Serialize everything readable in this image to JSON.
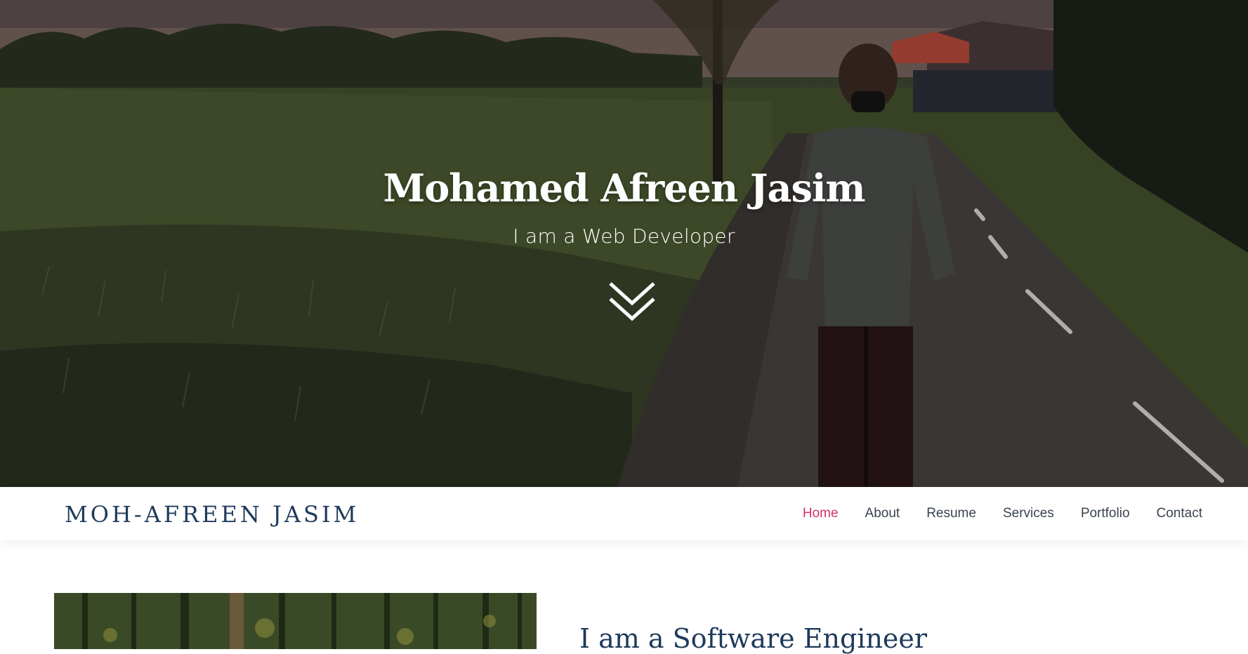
{
  "hero": {
    "title": "Mohamed Afreen Jasim",
    "subtitle": "I am a Web Developer",
    "scroll_icon": "double-chevron-down-icon"
  },
  "navbar": {
    "brand": "Moh-Afreen Jasim",
    "links": [
      {
        "label": "Home",
        "active": true
      },
      {
        "label": "About",
        "active": false
      },
      {
        "label": "Resume",
        "active": false
      },
      {
        "label": "Services",
        "active": false
      },
      {
        "label": "Portfolio",
        "active": false
      },
      {
        "label": "Contact",
        "active": false
      }
    ]
  },
  "about": {
    "heading": "I am a Software Engineer"
  },
  "colors": {
    "accent": "#d0326c",
    "brand": "#1e3a5a",
    "nav_text": "#3a4350"
  }
}
